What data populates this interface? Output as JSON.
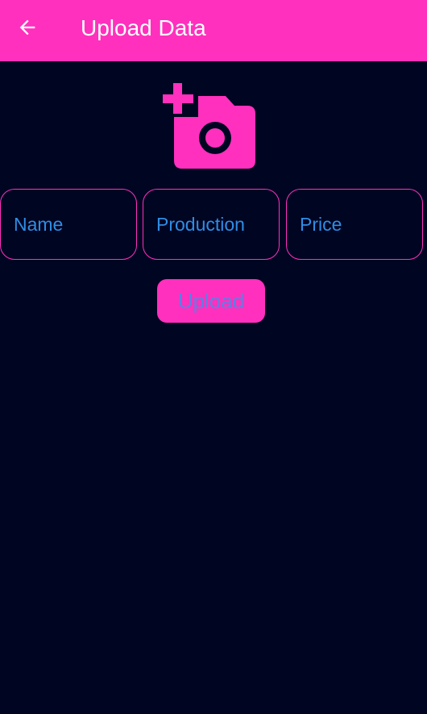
{
  "app_bar": {
    "title": "Upload Data",
    "back_icon": "arrow-left-icon"
  },
  "photo_picker": {
    "icon": "add-photo-camera-icon"
  },
  "form": {
    "name_placeholder": "Name",
    "production_placeholder": "Production",
    "price_placeholder": "Price",
    "name_value": "",
    "production_value": "",
    "price_value": ""
  },
  "actions": {
    "upload_label": "Upload"
  },
  "colors": {
    "accent": "#ff30bd",
    "background": "#000522",
    "field_text": "#2f8de4",
    "button_text": "#5b7fe6",
    "title_text": "#ffffff"
  }
}
